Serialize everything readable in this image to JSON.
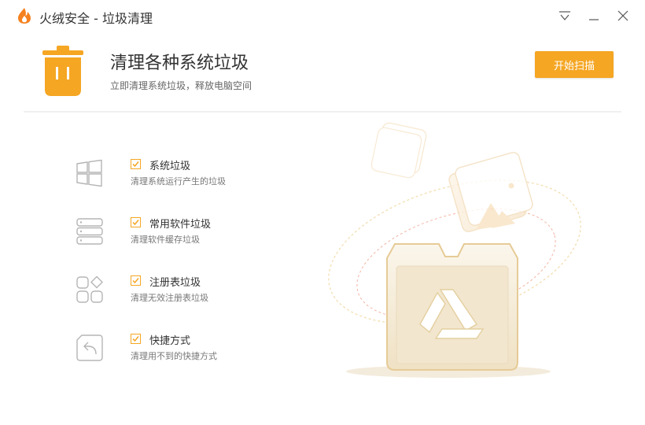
{
  "window": {
    "title": "火绒安全 - 垃圾清理",
    "controls": [
      "menu-icon",
      "minimize-icon",
      "close-icon"
    ]
  },
  "header": {
    "headline": "清理各种系统垃圾",
    "subline": "立即清理系统垃圾，释放电脑空间",
    "start_label": "开始扫描"
  },
  "items": [
    {
      "icon": "windows-icon",
      "checked": true,
      "title": "系统垃圾",
      "desc": "清理系统运行产生的垃圾"
    },
    {
      "icon": "server-stack-icon",
      "checked": true,
      "title": "常用软件垃圾",
      "desc": "清理软件缓存垃圾"
    },
    {
      "icon": "grid-tiles-icon",
      "checked": true,
      "title": "注册表垃圾",
      "desc": "清理无效注册表垃圾"
    },
    {
      "icon": "shortcut-icon",
      "checked": true,
      "title": "快捷方式",
      "desc": "清理用不到的快捷方式"
    }
  ],
  "colors": {
    "accent": "#f5a623",
    "illustration": "#e9c98d"
  }
}
